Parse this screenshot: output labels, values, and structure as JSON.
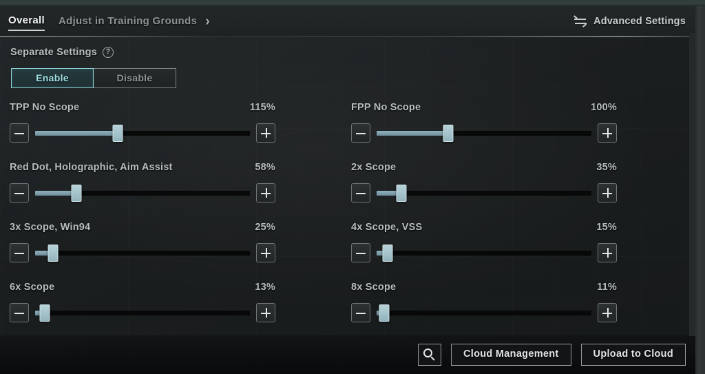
{
  "header": {
    "tabs": [
      {
        "label": "Overall",
        "active": true
      },
      {
        "label": "Adjust in Training Grounds",
        "active": false
      }
    ],
    "chevron": "›",
    "advanced_settings_label": "Advanced Settings",
    "advanced_settings_icon": "swap-arrows-icon"
  },
  "separate_settings": {
    "label": "Separate Settings",
    "help_icon": "help-question-icon",
    "help_glyph": "?",
    "options": [
      {
        "label": "Enable",
        "selected": true
      },
      {
        "label": "Disable",
        "selected": false
      }
    ]
  },
  "sliders": [
    {
      "name": "TPP No Scope",
      "value": "115%",
      "percent": 115,
      "max": 300,
      "column": "left"
    },
    {
      "name": "FPP No Scope",
      "value": "100%",
      "percent": 100,
      "max": 300,
      "column": "right"
    },
    {
      "name": "Red Dot, Holographic, Aim Assist",
      "value": "58%",
      "percent": 58,
      "max": 300,
      "column": "left"
    },
    {
      "name": "2x Scope",
      "value": "35%",
      "percent": 35,
      "max": 300,
      "column": "right"
    },
    {
      "name": "3x Scope, Win94",
      "value": "25%",
      "percent": 25,
      "max": 300,
      "column": "left"
    },
    {
      "name": "4x Scope, VSS",
      "value": "15%",
      "percent": 15,
      "max": 300,
      "column": "right"
    },
    {
      "name": "6x Scope",
      "value": "13%",
      "percent": 13,
      "max": 300,
      "column": "left"
    },
    {
      "name": "8x Scope",
      "value": "11%",
      "percent": 11,
      "max": 300,
      "column": "right"
    }
  ],
  "slider_controls": {
    "decrement_icon": "minus-icon",
    "increment_icon": "plus-icon"
  },
  "bottom_bar": {
    "search_icon": "search-magnifier-icon",
    "buttons": [
      {
        "label": "Cloud Management"
      },
      {
        "label": "Upload to Cloud"
      }
    ]
  },
  "colors": {
    "accent_teal": "#8fd6da",
    "slider_fill": "#7d9dab",
    "slider_thumb": "#a9c8d0",
    "track_empty": "#080909",
    "text_primary": "#e2e7e8",
    "text_secondary": "#b6bdbf",
    "panel_bg": "#1d2021",
    "top_strip": "#36413f"
  }
}
